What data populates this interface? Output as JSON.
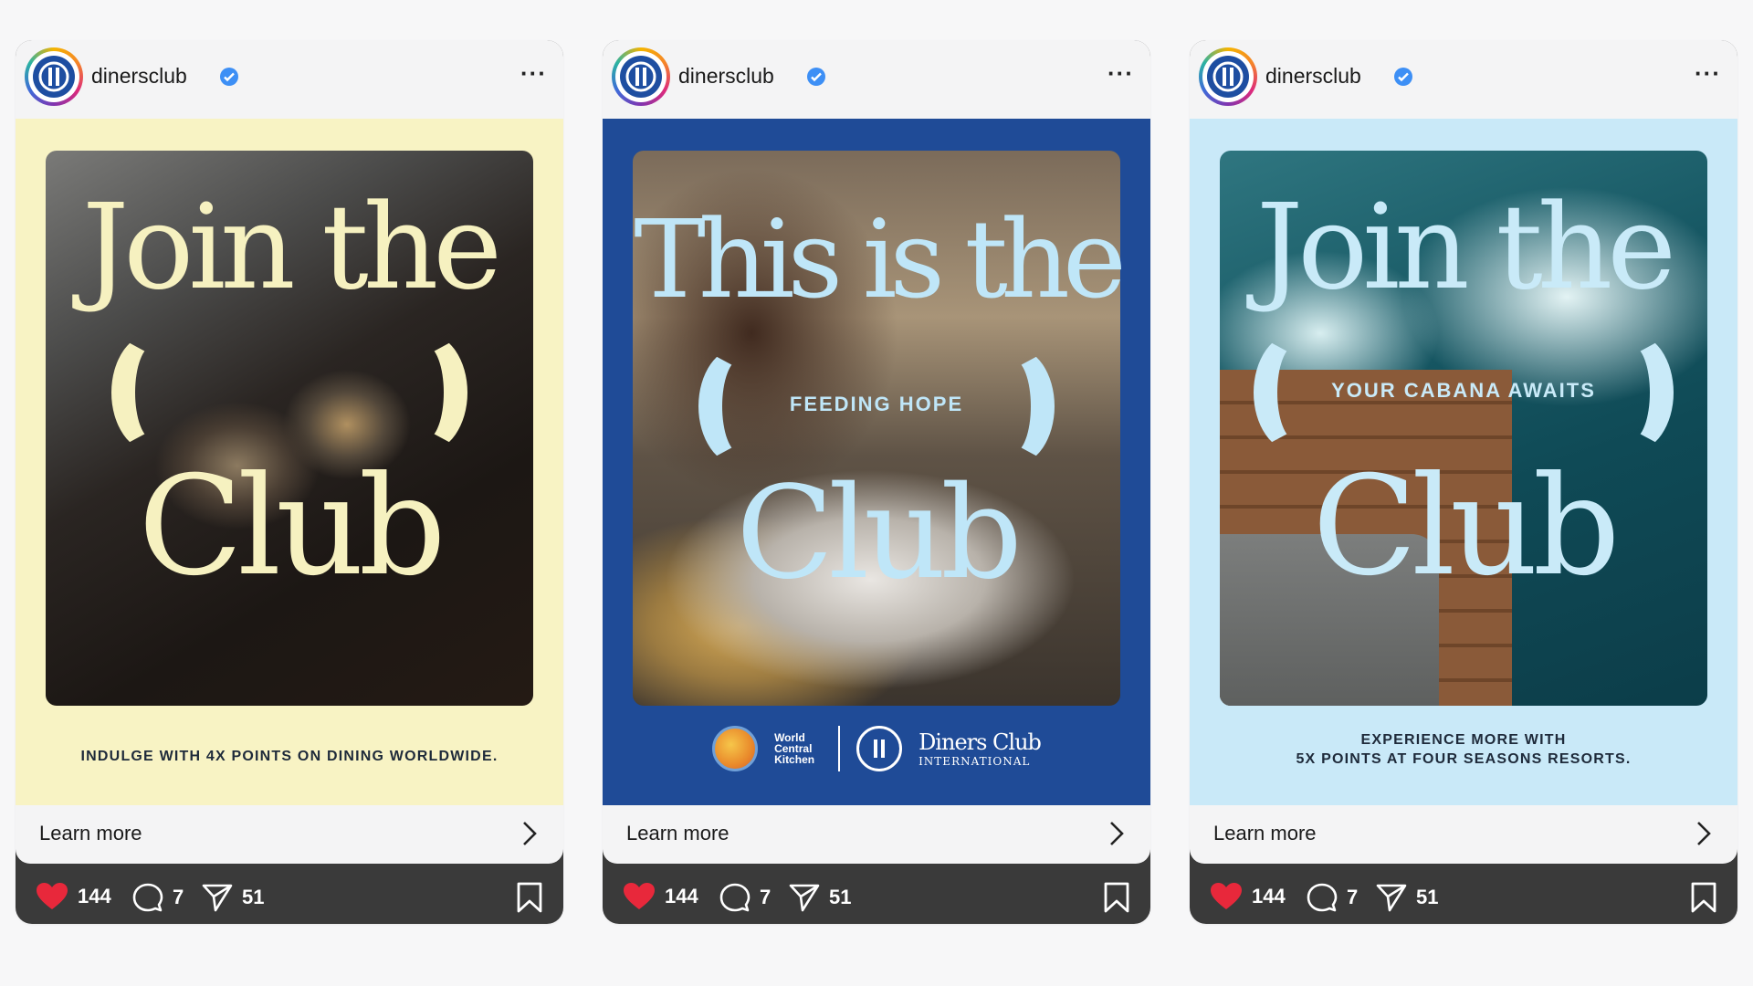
{
  "posts": [
    {
      "username": "dinersclub",
      "headline_top": "Join the",
      "headline_bottom": "Club",
      "photo_tagline": "",
      "caption_lines": [
        "INDULGE WITH 4X POINTS ON DINING WORLDWIDE."
      ],
      "cta": "Learn more",
      "likes": "144",
      "comments": "7",
      "shares": "51"
    },
    {
      "username": "dinersclub",
      "headline_top": "This is the",
      "headline_bottom": "Club",
      "photo_tagline": "FEEDING HOPE",
      "partner_wck": "World Central Kitchen",
      "partner_dc_line1": "Diners Club",
      "partner_dc_line2": "INTERNATIONAL",
      "cta": "Learn more",
      "likes": "144",
      "comments": "7",
      "shares": "51"
    },
    {
      "username": "dinersclub",
      "headline_top": "Join the",
      "headline_bottom": "Club",
      "photo_tagline": "YOUR CABANA AWAITS",
      "caption_lines": [
        "EXPERIENCE MORE WITH",
        "5X POINTS AT FOUR SEASONS RESORTS."
      ],
      "cta": "Learn more",
      "likes": "144",
      "comments": "7",
      "shares": "51"
    }
  ],
  "icons": {
    "verified": "verified-badge-icon",
    "more": "more-options-icon",
    "chevron": "chevron-right-icon",
    "like": "heart-icon",
    "comment": "comment-icon",
    "share": "send-icon",
    "save": "bookmark-icon"
  },
  "colors": {
    "post1_bg": "#f8f3c4",
    "post2_bg": "#1f4b97",
    "post3_bg": "#c9e9f8",
    "like": "#e8283b",
    "action_bar": "#3a3a3a",
    "verified": "#3d8ff5"
  }
}
